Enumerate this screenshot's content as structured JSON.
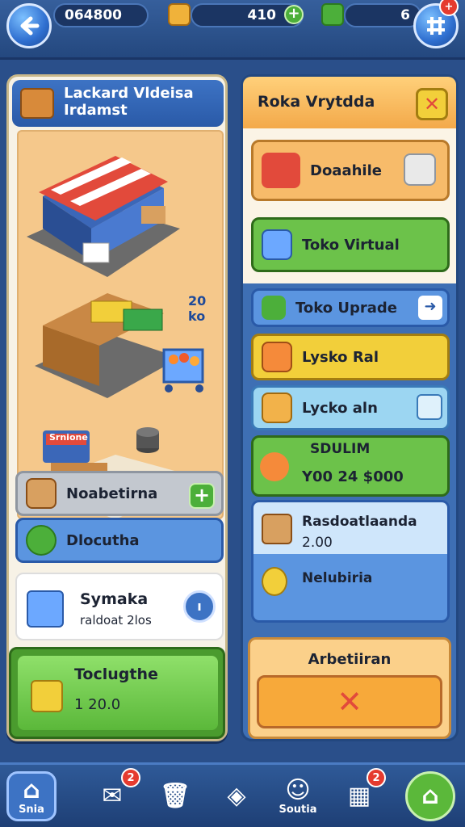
{
  "topbar": {
    "back_icon": "arrow-left-icon",
    "coins": "064800",
    "gold": "410",
    "gems": "6",
    "menu_icon": "grid-icon",
    "menu_badge": "+"
  },
  "left": {
    "title_line1": "Lackard Vldeisa",
    "title_line2": "Irdamst",
    "scene_label": "20 ko",
    "store_sign": "Srnione",
    "items": [
      {
        "label": "Noabetirna"
      },
      {
        "label": "Dlocutha"
      }
    ],
    "sym_card": {
      "title": "Symaka",
      "sub": "raldoat 2los"
    },
    "green_card": {
      "title": "Toclugthe",
      "value": "1 20.0"
    }
  },
  "right": {
    "title": "Roka Vrytdda",
    "close_icon": "close-icon",
    "buttons": [
      {
        "label": "Doaahile"
      },
      {
        "label": "Toko Virtual"
      },
      {
        "label": "Toko Uprade"
      },
      {
        "label": "Lysko Ral"
      },
      {
        "label": "Lycko aln"
      }
    ],
    "promo": {
      "title": "SDULIM",
      "value": "Y00 24 $000"
    },
    "info1": {
      "title": "Rasdoatlaanda",
      "sub": "2.00"
    },
    "info2": {
      "title": "Nelubiria"
    },
    "footer": {
      "title": "Arbetiiran"
    }
  },
  "bottom_nav": [
    {
      "label": "Snia",
      "icon": "home-icon"
    },
    {
      "label": "",
      "icon": "message-icon",
      "badge": "2"
    },
    {
      "label": "",
      "icon": "trash-icon"
    },
    {
      "label": "",
      "icon": "tag-icon"
    },
    {
      "label": "Soutia",
      "icon": "social-icon"
    },
    {
      "label": "",
      "icon": "calendar-icon",
      "badge": "2"
    },
    {
      "label": "",
      "icon": "house-icon"
    }
  ],
  "colors": {
    "accent": "#2f6fd0",
    "green": "#5bb83a",
    "orange": "#f3a94a",
    "yellow": "#f2cf3a"
  }
}
